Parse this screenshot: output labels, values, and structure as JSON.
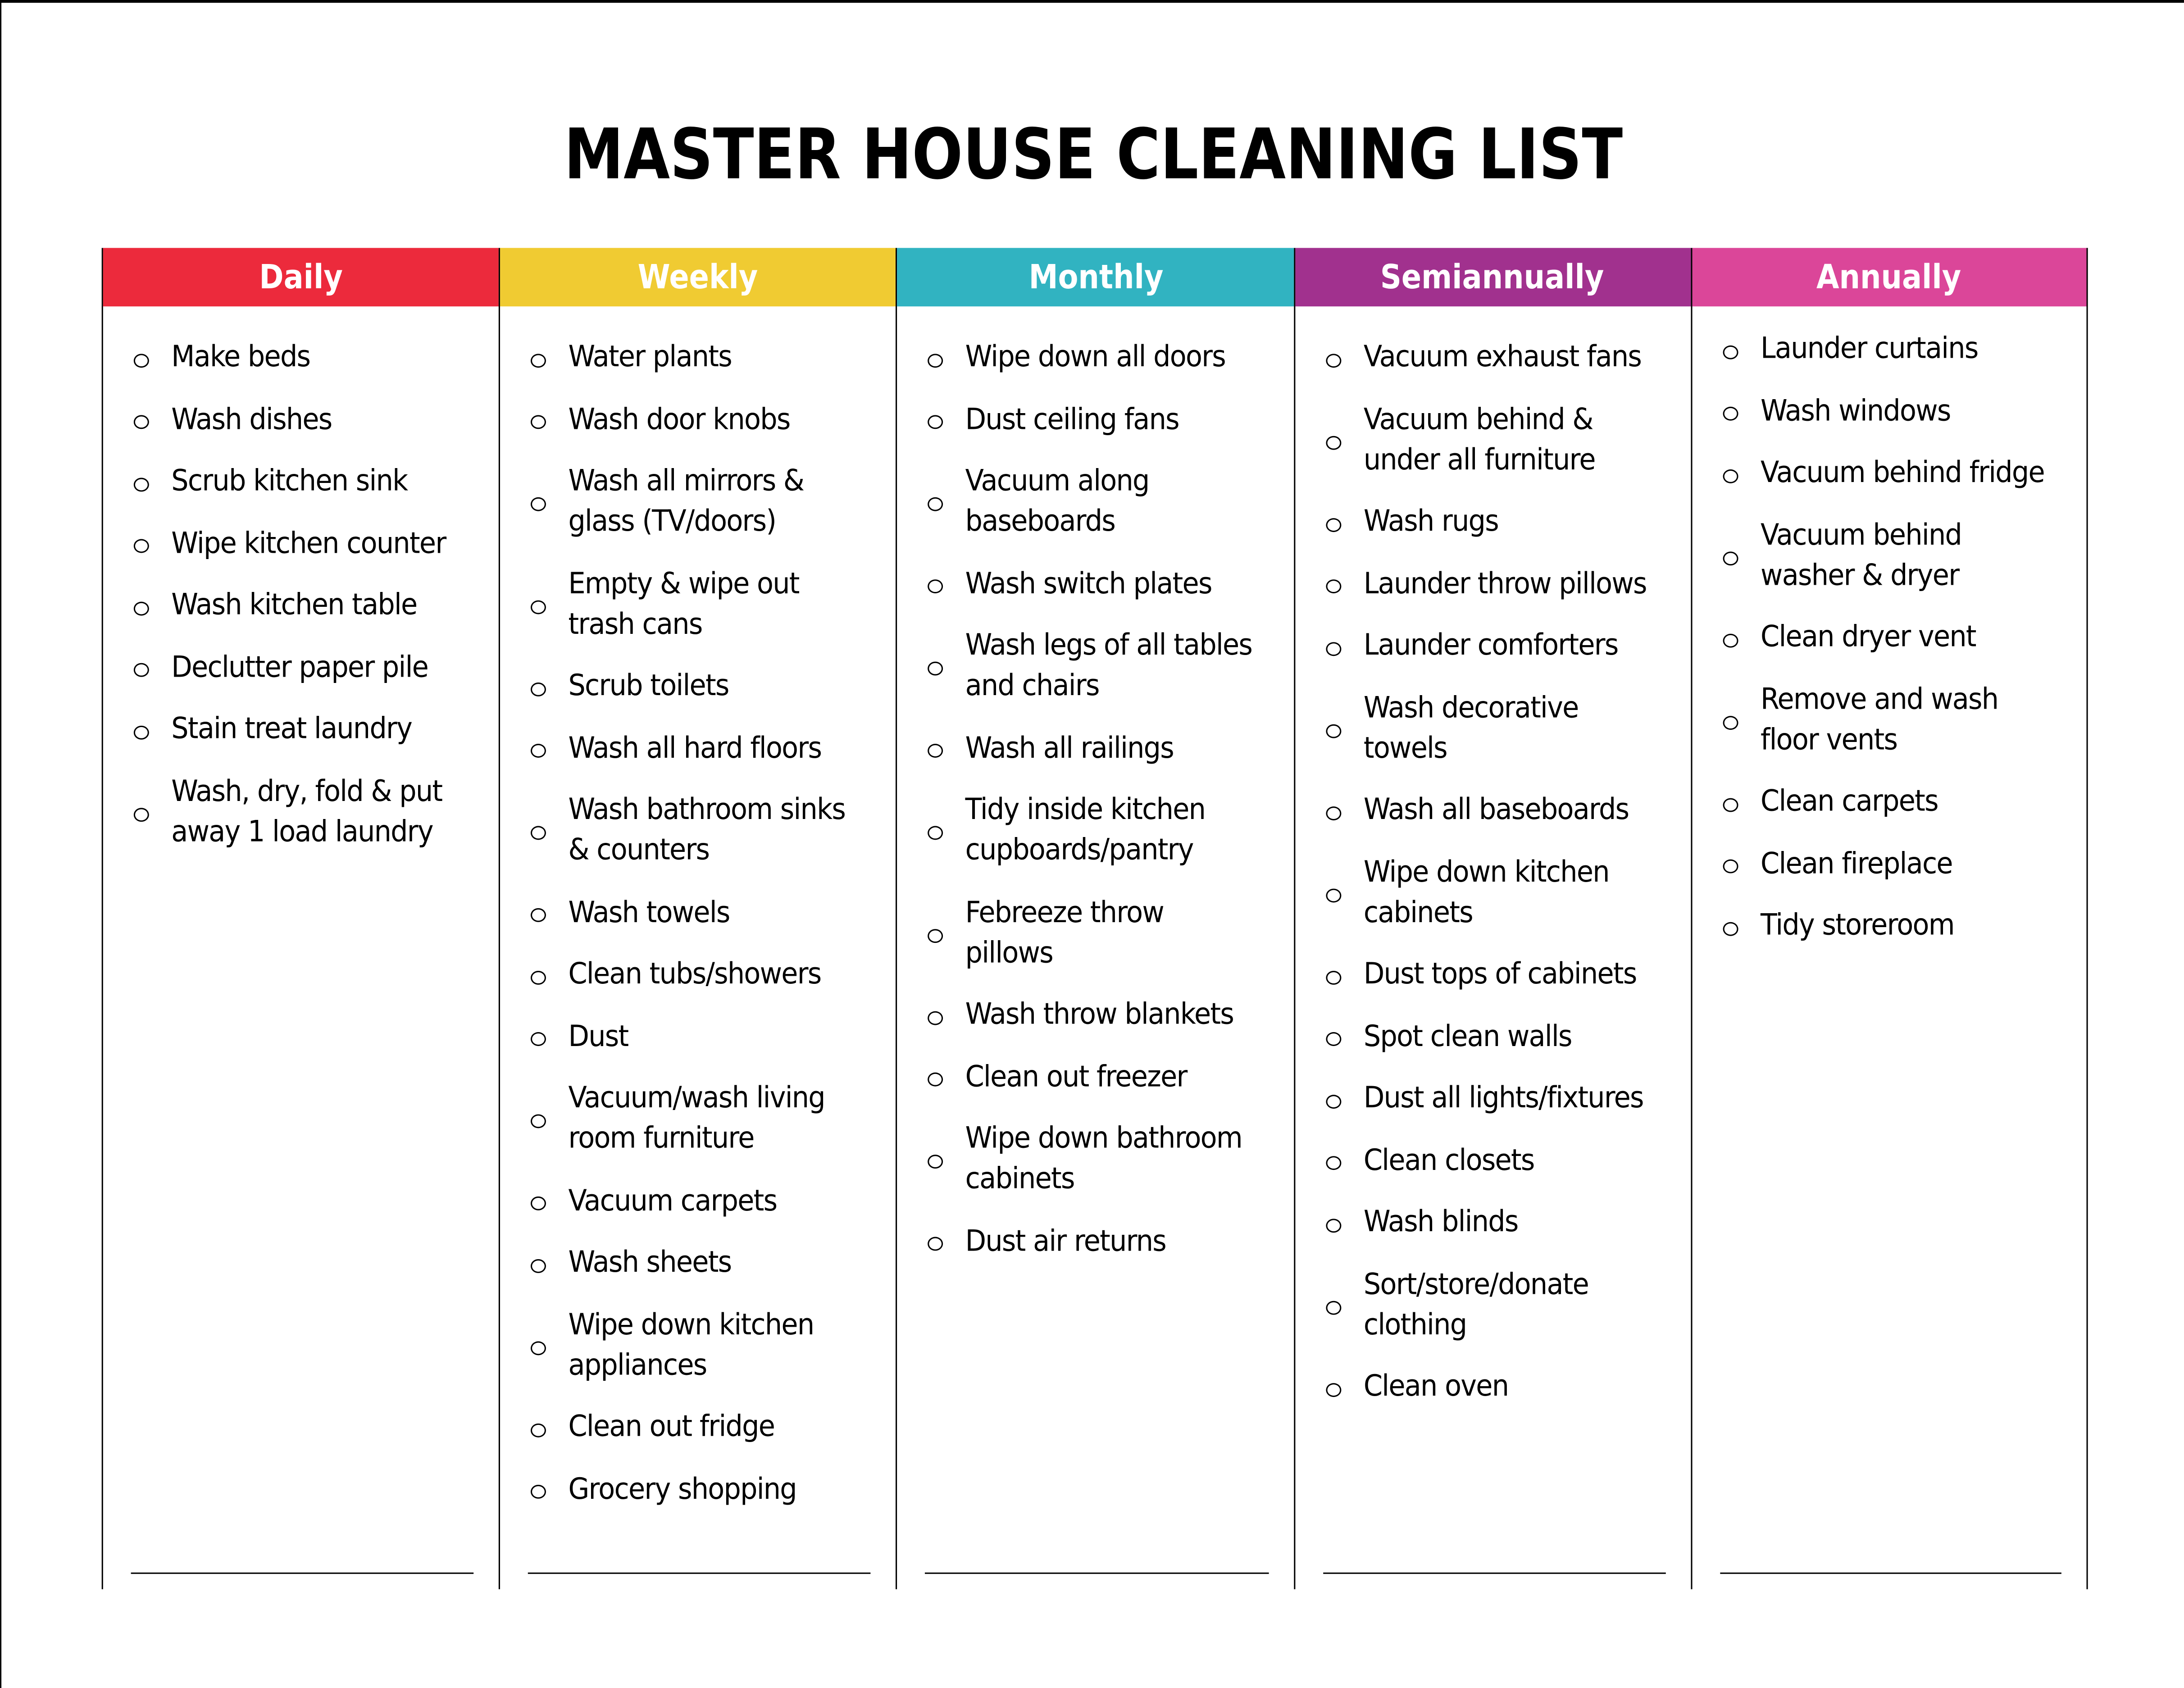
{
  "title": "MASTER HOUSE CLEANING LIST",
  "columns": [
    {
      "label": "Daily",
      "color": "#EC2A3C",
      "items": [
        "Make beds",
        "Wash dishes",
        "Scrub kitchen sink",
        "Wipe kitchen counter",
        "Wash kitchen table",
        "Declutter paper pile",
        "Stain treat laundry",
        "Wash, dry, fold & put away 1 load laundry"
      ]
    },
    {
      "label": "Weekly",
      "color": "#F0CB32",
      "items": [
        "Water plants",
        "Wash door knobs",
        "Wash all mirrors & glass (TV/doors)",
        "Empty & wipe out trash cans",
        "Scrub toilets",
        "Wash all hard floors",
        "Wash bathroom sinks & counters",
        "Wash towels",
        "Clean tubs/showers",
        "Dust",
        "Vacuum/wash living room furniture",
        "Vacuum carpets",
        "Wash sheets",
        "Wipe down kitchen appliances",
        "Clean out fridge",
        "Grocery shopping"
      ]
    },
    {
      "label": "Monthly",
      "color": "#31B3C1",
      "items": [
        "Wipe down all doors",
        "Dust ceiling fans",
        "Vacuum along baseboards",
        "Wash switch plates",
        "Wash legs of all tables and chairs",
        "Wash all railings",
        "Tidy inside kitchen cupboards/pantry",
        "Febreeze throw pillows",
        "Wash throw blankets",
        "Clean out freezer",
        "Wipe down bathroom cabinets",
        "Dust air returns"
      ]
    },
    {
      "label": "Semiannually",
      "color": "#A1318E",
      "items": [
        "Vacuum exhaust fans",
        "Vacuum behind & under all furniture",
        "Wash rugs",
        "Launder throw pillows",
        "Launder comforters",
        "Wash decorative towels",
        "Wash all baseboards",
        "Wipe down kitchen cabinets",
        "Dust tops of cabinets",
        "Spot clean walls",
        "Dust all lights/fixtures",
        "Clean closets",
        "Wash blinds",
        "Sort/store/donate clothing",
        "Clean oven"
      ]
    },
    {
      "label": "Annually",
      "color": "#DB4699",
      "items": [
        "Launder curtains",
        "Wash windows",
        "Vacuum behind fridge",
        "Vacuum behind washer & dryer",
        "Clean dryer vent",
        "Remove and wash floor vents",
        "Clean carpets",
        "Clean fireplace",
        "Tidy storeroom"
      ]
    }
  ]
}
